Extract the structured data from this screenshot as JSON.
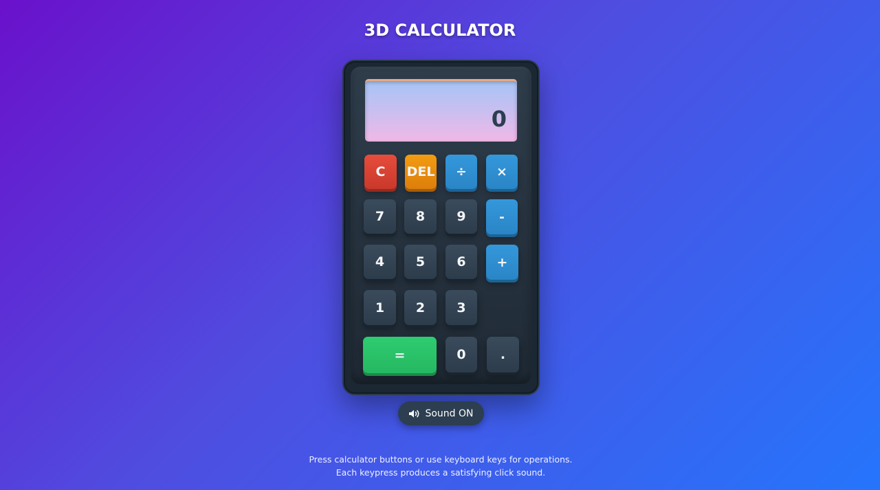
{
  "page": {
    "title": "3D CALCULATOR"
  },
  "display": {
    "value": "0"
  },
  "keys": {
    "clear": "C",
    "delete": "DEL",
    "divide": "÷",
    "multiply": "×",
    "seven": "7",
    "eight": "8",
    "nine": "9",
    "minus": "-",
    "four": "4",
    "five": "5",
    "six": "6",
    "plus": "+",
    "one": "1",
    "two": "2",
    "three": "3",
    "equals": "=",
    "zero": "0",
    "decimal": "."
  },
  "sound": {
    "icon": "speaker-icon",
    "label": "Sound ON"
  },
  "instructions": {
    "text": "Press calculator buttons or use keyboard keys for operations. Each keypress produces a satisfying click sound."
  },
  "colors": {
    "background_start": "#6a11cb",
    "background_end": "#2575fc",
    "number_key": "#34495e",
    "operator_key": "#3498db",
    "clear_key": "#e74c3c",
    "delete_key": "#f39c12",
    "equals_key": "#2ecc71",
    "display_text": "#2c3e50"
  }
}
